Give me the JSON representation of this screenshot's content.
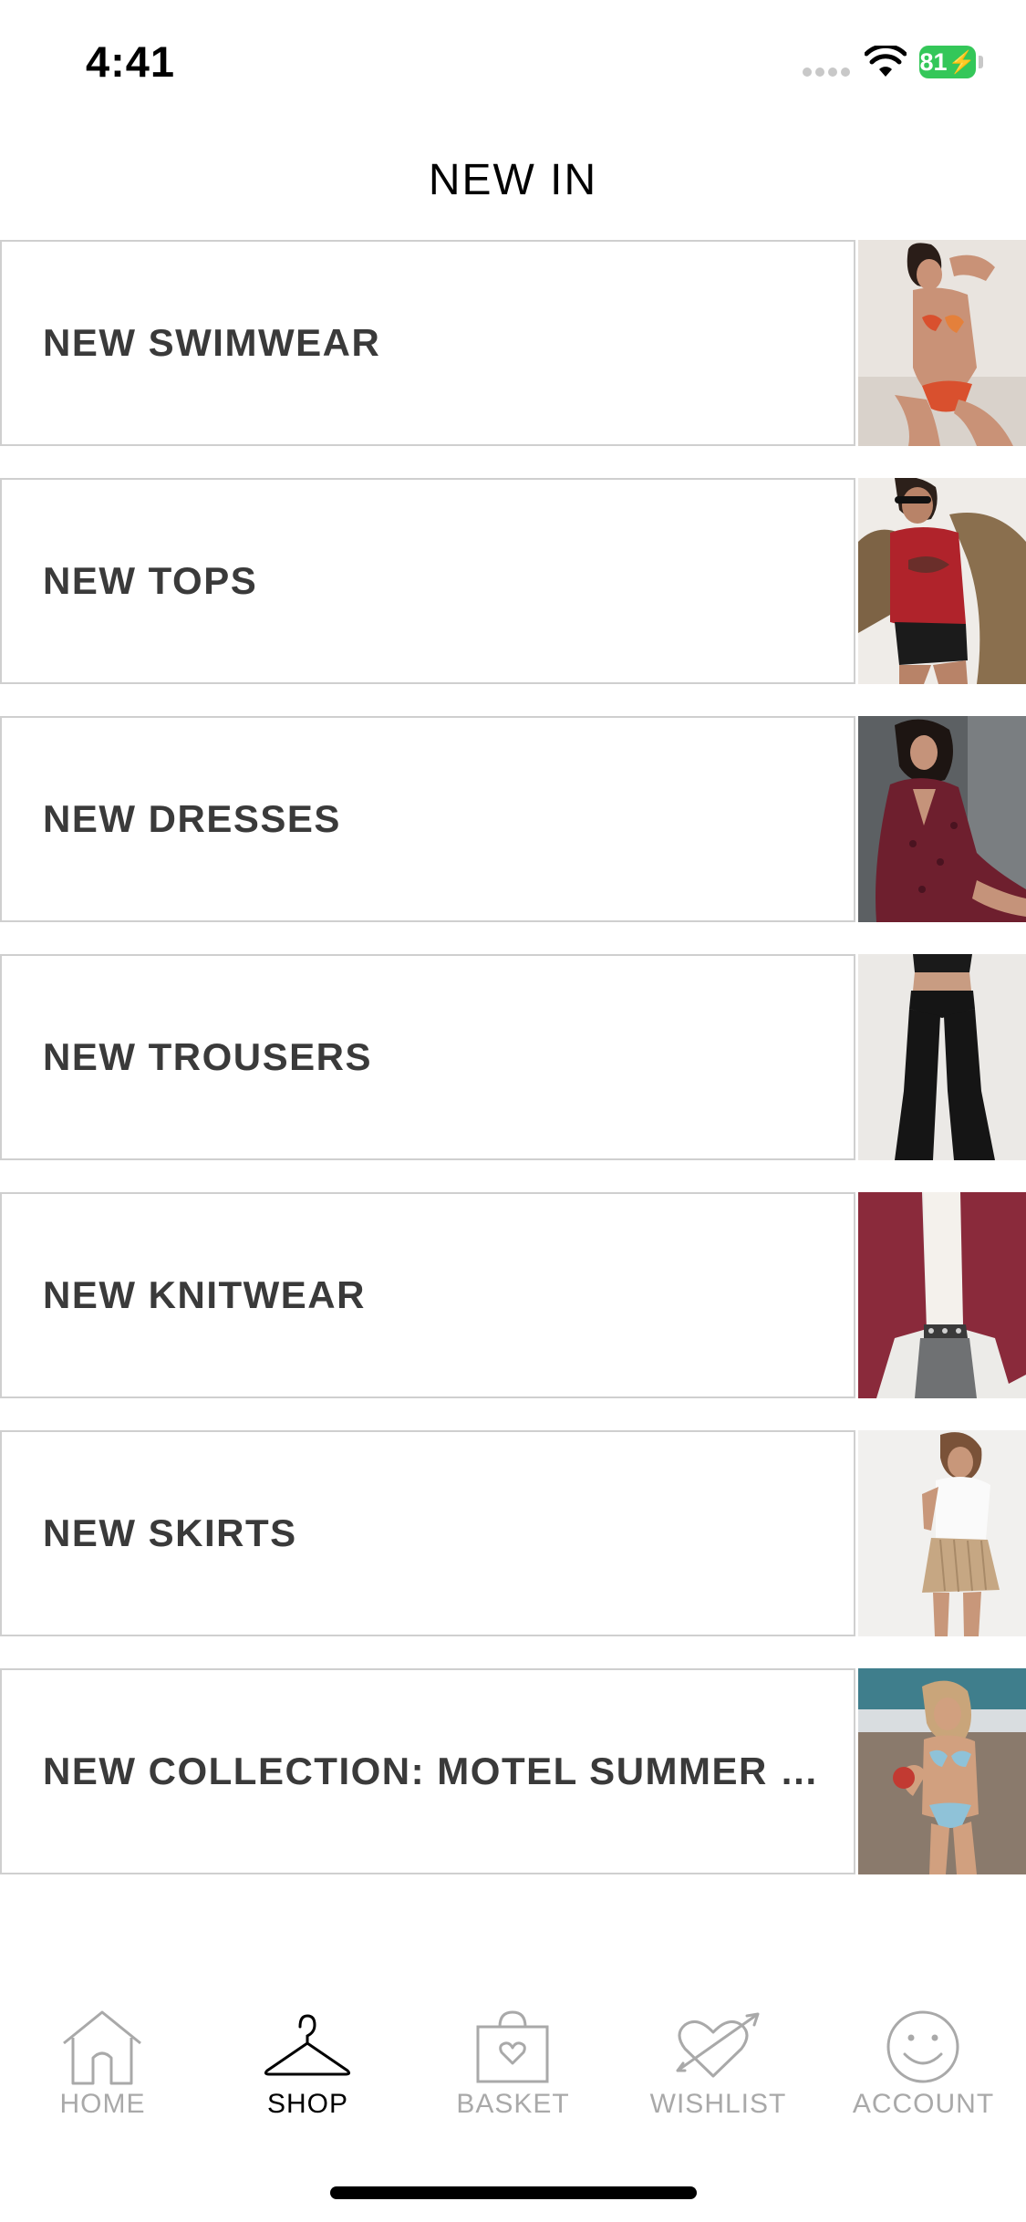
{
  "status_bar": {
    "time": "4:41",
    "battery": "81"
  },
  "header": {
    "title": "NEW IN"
  },
  "categories": [
    {
      "label": "NEW SWIMWEAR"
    },
    {
      "label": "NEW TOPS"
    },
    {
      "label": "NEW DRESSES"
    },
    {
      "label": "NEW TROUSERS"
    },
    {
      "label": "NEW KNITWEAR"
    },
    {
      "label": "NEW SKIRTS"
    },
    {
      "label": "NEW COLLECTION: MOTEL SUMMER D..."
    }
  ],
  "tab_bar": {
    "tabs": [
      {
        "label": "HOME",
        "icon": "home-icon",
        "active": false
      },
      {
        "label": "SHOP",
        "icon": "hanger-icon",
        "active": true
      },
      {
        "label": "BASKET",
        "icon": "basket-icon",
        "active": false
      },
      {
        "label": "WISHLIST",
        "icon": "heart-arrow-icon",
        "active": false
      },
      {
        "label": "ACCOUNT",
        "icon": "smiley-icon",
        "active": false
      }
    ]
  },
  "colors": {
    "active_tab": "#000000",
    "inactive_tab": "#a9a9a9",
    "battery": "#34c759",
    "row_border": "#cfcfcf"
  }
}
